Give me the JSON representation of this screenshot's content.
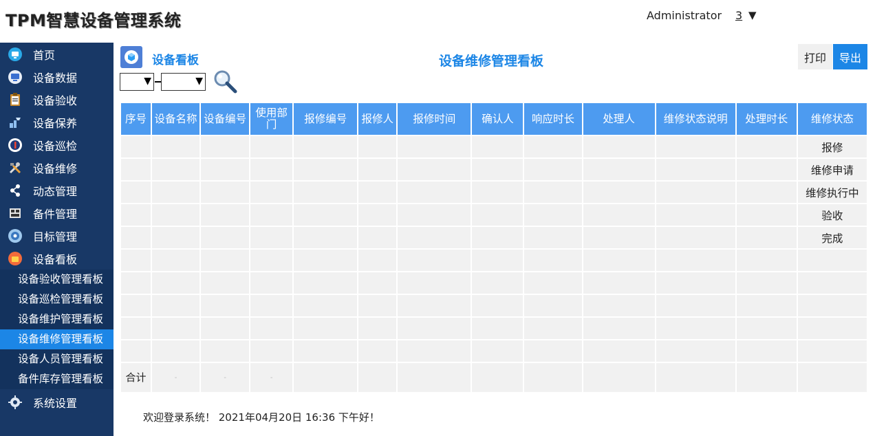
{
  "app": {
    "title": "TPM智慧设备管理系统"
  },
  "user": {
    "name": "Administrator",
    "count": "3",
    "caret": "▼"
  },
  "sidebar": {
    "items": [
      {
        "label": "首页",
        "icon": "home-icon"
      },
      {
        "label": "设备数据",
        "icon": "monitor-icon"
      },
      {
        "label": "设备验收",
        "icon": "clipboard-icon"
      },
      {
        "label": "设备保养",
        "icon": "maintenance-icon"
      },
      {
        "label": "设备巡检",
        "icon": "inspection-icon"
      },
      {
        "label": "设备维修",
        "icon": "tools-icon"
      },
      {
        "label": "动态管理",
        "icon": "share-icon"
      },
      {
        "label": "备件管理",
        "icon": "parts-icon"
      },
      {
        "label": "目标管理",
        "icon": "target-icon"
      },
      {
        "label": "设备看板",
        "icon": "dashboard-icon"
      }
    ],
    "submenu": [
      "设备验收管理看板",
      "设备巡检管理看板",
      "设备维护管理看板",
      "设备维修管理看板",
      "设备人员管理看板",
      "备件库存管理看板"
    ],
    "active_submenu": 3,
    "settings": {
      "label": "系统设置",
      "icon": "gear-icon"
    }
  },
  "panel": {
    "label": "设备看板",
    "board_title": "设备维修管理看板",
    "print_label": "打印",
    "export_label": "导出",
    "filter": {
      "select_arrow": "▼"
    }
  },
  "table": {
    "columns": [
      "序号",
      "设备名称",
      "设备编号",
      "使用部门",
      "报修编号",
      "报修人",
      "报修时间",
      "确认人",
      "响应时长",
      "处理人",
      "维修状态说明",
      "处理时长",
      "维修状态"
    ],
    "status_values": [
      "报修",
      "维修申请",
      "维修执行中",
      "验收",
      "完成"
    ],
    "row_count": 10,
    "total_label": "合计",
    "total_placeholders": [
      "-",
      "-",
      "-"
    ]
  },
  "footer": {
    "text": "欢迎登录系统！ 2021年04月20日 16:36 下午好！"
  },
  "colors": {
    "sidebar": "#183866",
    "accent": "#1c86e6",
    "header_cell": "#4d9bf0",
    "cell": "#f1f1f1"
  }
}
